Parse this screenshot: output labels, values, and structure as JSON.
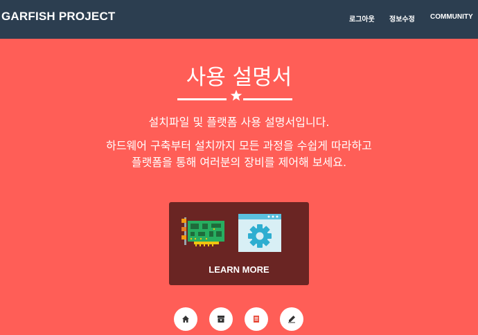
{
  "navbar": {
    "brand": "GARFISH PROJECT",
    "links": {
      "logout": "로그아웃",
      "profile_edit": "정보수정",
      "community": "COMMUNITY"
    }
  },
  "hero": {
    "title": "사용 설명서",
    "subtitle": "설치파일 및 플랫폼 사용 설명서입니다.",
    "description": "하드웨어 구축부터 설치까지 모든 과정을 수쉽게 따라하고 플랫폼을 통해 여러분의 장비를 제어해 보세요.",
    "divider_icon": "star-icon"
  },
  "card": {
    "label": "LEARN MORE",
    "icons": [
      "circuit-board-icon",
      "settings-window-icon"
    ]
  },
  "bottom_buttons": [
    "home-icon",
    "archive-icon",
    "book-icon",
    "edit-icon"
  ],
  "colors": {
    "background": "#ff5e57",
    "navbar": "#2c3e50",
    "card": "#6a2523",
    "text": "#ffffff"
  }
}
